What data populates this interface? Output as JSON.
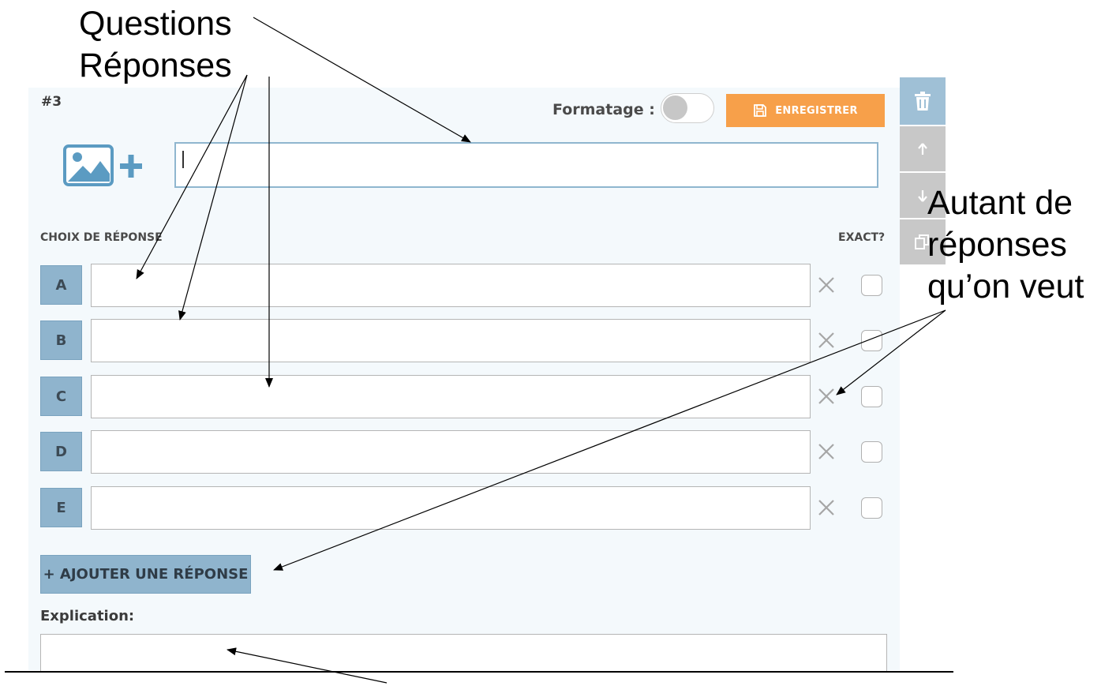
{
  "annotations": {
    "questions": "Questions",
    "reponses": "Réponses",
    "autant_line1": "Autant de",
    "autant_line2": "réponses",
    "autant_line3": "qu’on veut"
  },
  "question_card": {
    "number": "#3",
    "formatting_label": "Formatage :",
    "formatting_enabled": false,
    "save_label": "ENREGISTRER",
    "question_value": "",
    "choices_header": "CHOIX DE RÉPONSE",
    "exact_header": "EXACT?",
    "answers": [
      {
        "letter": "A",
        "value": "",
        "exact": false
      },
      {
        "letter": "B",
        "value": "",
        "exact": false
      },
      {
        "letter": "C",
        "value": "",
        "exact": false
      },
      {
        "letter": "D",
        "value": "",
        "exact": false
      },
      {
        "letter": "E",
        "value": "",
        "exact": false
      }
    ],
    "add_answer_label": "+ AJOUTER UNE RÉPONSE",
    "explanation_label": "Explication:",
    "explanation_value": ""
  },
  "side_toolbar": {
    "buttons": [
      {
        "icon": "trash-icon",
        "color": "#9fc0d6"
      },
      {
        "icon": "arrow-up-icon",
        "color": "#c8c8c8"
      },
      {
        "icon": "arrow-down-icon",
        "color": "#c8c8c8"
      },
      {
        "icon": "copy-icon",
        "color": "#c8c8c8"
      }
    ]
  },
  "colors": {
    "accent_orange": "#f7a04a",
    "accent_blue": "#8fb4cd",
    "card_background": "#f4f9fc"
  }
}
